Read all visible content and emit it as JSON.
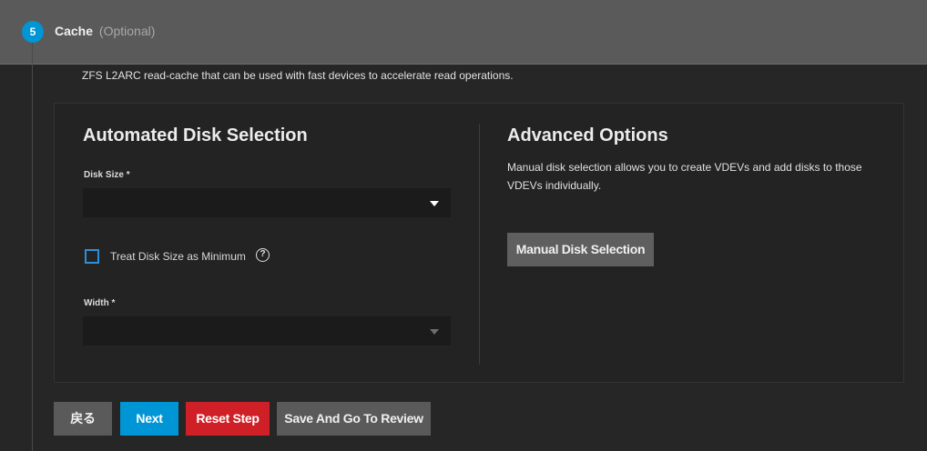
{
  "step": {
    "number": "5",
    "title": "Cache",
    "optional": "(Optional)",
    "description": "ZFS L2ARC read-cache that can be used with fast devices to accelerate read operations."
  },
  "automated": {
    "title": "Automated Disk Selection",
    "disk_size_label": "Disk Size *",
    "disk_size_value": "",
    "treat_min_label": "Treat Disk Size as Minimum",
    "treat_min_checked": false,
    "help_glyph": "?",
    "width_label": "Width *",
    "width_value": ""
  },
  "advanced": {
    "title": "Advanced Options",
    "text": "Manual disk selection allows you to create VDEVs and add disks to those VDEVs individually.",
    "manual_button": "Manual Disk Selection"
  },
  "footer": {
    "back": "戻る",
    "next": "Next",
    "reset": "Reset Step",
    "review": "Save And Go To Review"
  },
  "colors": {
    "accent": "#0095d5",
    "danger": "#cf2027",
    "header_bg": "#5a5a5a",
    "page_bg": "#262626"
  },
  "icons": {
    "step_badge": "step-number-badge",
    "help": "help-circle-icon",
    "dropdown": "chevron-down-icon"
  }
}
